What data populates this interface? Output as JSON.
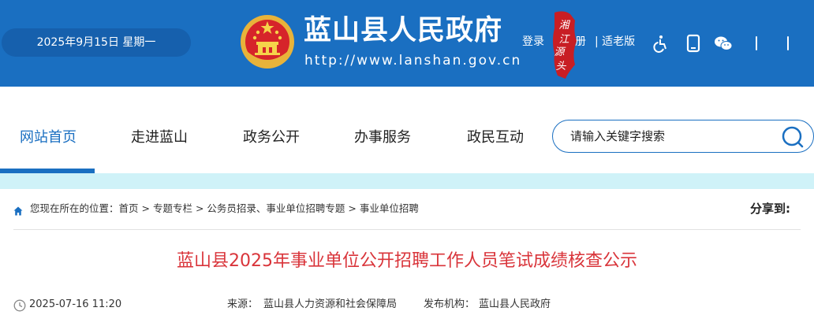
{
  "header": {
    "date": "2025年9月15日 星期一",
    "site_title": "蓝山县人民政府",
    "site_url": "http://www.lanshan.gov.cn",
    "login": "登录",
    "register": "册",
    "elder_mode": "| 适老版",
    "seal_text": "湘江源头",
    "brand_color": "#1a6fc1"
  },
  "icons": {
    "accessibility": "wheelchair-icon",
    "mobile": "mobile-icon",
    "wechat": "wechat-icon",
    "weibo": "weibo-icon",
    "app": "app-icon"
  },
  "nav": {
    "items": [
      {
        "label": "网站首页",
        "active": true
      },
      {
        "label": "走进蓝山"
      },
      {
        "label": "政务公开"
      },
      {
        "label": "办事服务"
      },
      {
        "label": "政民互动"
      }
    ]
  },
  "search": {
    "placeholder": "请输入关键字搜索"
  },
  "breadcrumb": {
    "prefix": "您现在所在的位置：",
    "items": [
      "首页",
      "专题专栏",
      "公务员招录、事业单位招聘专题",
      "事业单位招聘"
    ],
    "separator": " > "
  },
  "share": {
    "label": "分享到:"
  },
  "article": {
    "title": "蓝山县2025年事业单位公开招聘工作人员笔试成绩核查公示",
    "title_color": "#d9343a",
    "date": "2025-07-16 11:20",
    "source_label": "来源：",
    "source": "蓝山县人力资源和社会保障局",
    "org_label": "发布机构：",
    "org": "蓝山县人民政府"
  }
}
